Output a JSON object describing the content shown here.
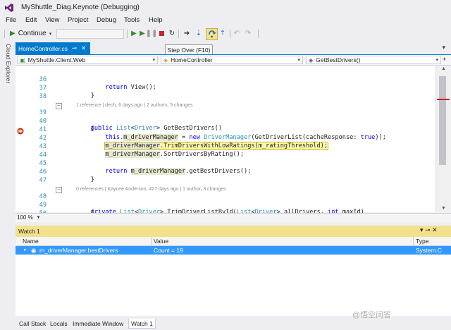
{
  "window": {
    "title": "MyShuttle_Diag.Keynote (Debugging)"
  },
  "menu": [
    "File",
    "Edit",
    "View",
    "Project",
    "Debug",
    "Tools",
    "Help"
  ],
  "toolbar": {
    "continue_label": "Continue",
    "tooltip": "Step Over (F10)"
  },
  "sidebar": {
    "cloud_explorer": "Cloud Explorer"
  },
  "tab": {
    "label": "HomeController.cs"
  },
  "nav": {
    "project": "MyShuttle.Client.Web",
    "class": "HomeController",
    "member": "GetBestDrivers()"
  },
  "code_lines": [
    {
      "num": "36",
      "text": "        return View();"
    },
    {
      "num": "37",
      "text": "    }"
    },
    {
      "num": "38",
      "text": ""
    },
    {
      "meta": "1 reference | dech, 6 days ago | 2 authors, 5 changes"
    },
    {
      "num": "39",
      "text": "    public List<Driver> GetBestDrivers()"
    },
    {
      "num": "40",
      "text": "    {"
    },
    {
      "num": "41",
      "text": "        this.m_driverManager = new DriverManager(GetDriverList(cacheResponse: true));"
    },
    {
      "num": "42",
      "text": "        m_driverManager.TrimDriversWithLowRatings(m_ratingThreshold);"
    },
    {
      "num": "43",
      "text": "        m_driverManager.SortDriversByRating();"
    },
    {
      "num": "44",
      "text": ""
    },
    {
      "num": "45",
      "text": "        return m_driverManager.getBestDrivers();"
    },
    {
      "num": "46",
      "text": "    }"
    },
    {
      "num": "47",
      "text": ""
    },
    {
      "meta": "0 references | Kaycee Anderson, 427 days ago | 1 author, 3 changes"
    },
    {
      "num": "48",
      "text": "    private List<Driver> TrimDriverListById(List<Driver> allDrivers, int maxId)"
    },
    {
      "num": "49",
      "text": "    {"
    },
    {
      "num": "50",
      "text": ""
    }
  ],
  "editor": {
    "zoom": "100 %"
  },
  "watch": {
    "title": "Watch 1",
    "columns": [
      "Name",
      "Value",
      "Type"
    ],
    "rows": [
      {
        "name": "m_driverManager.bestDrivers",
        "value": "Count = 19",
        "type": "System.C"
      }
    ]
  },
  "bottom_tabs": [
    "Call Stack",
    "Locals",
    "Immediate Window",
    "Watch 1"
  ],
  "watermark": "@悟空问答",
  "colors": {
    "accent": "#007acc",
    "debug_highlight": "#f3e08a",
    "selection": "#3399ff"
  }
}
